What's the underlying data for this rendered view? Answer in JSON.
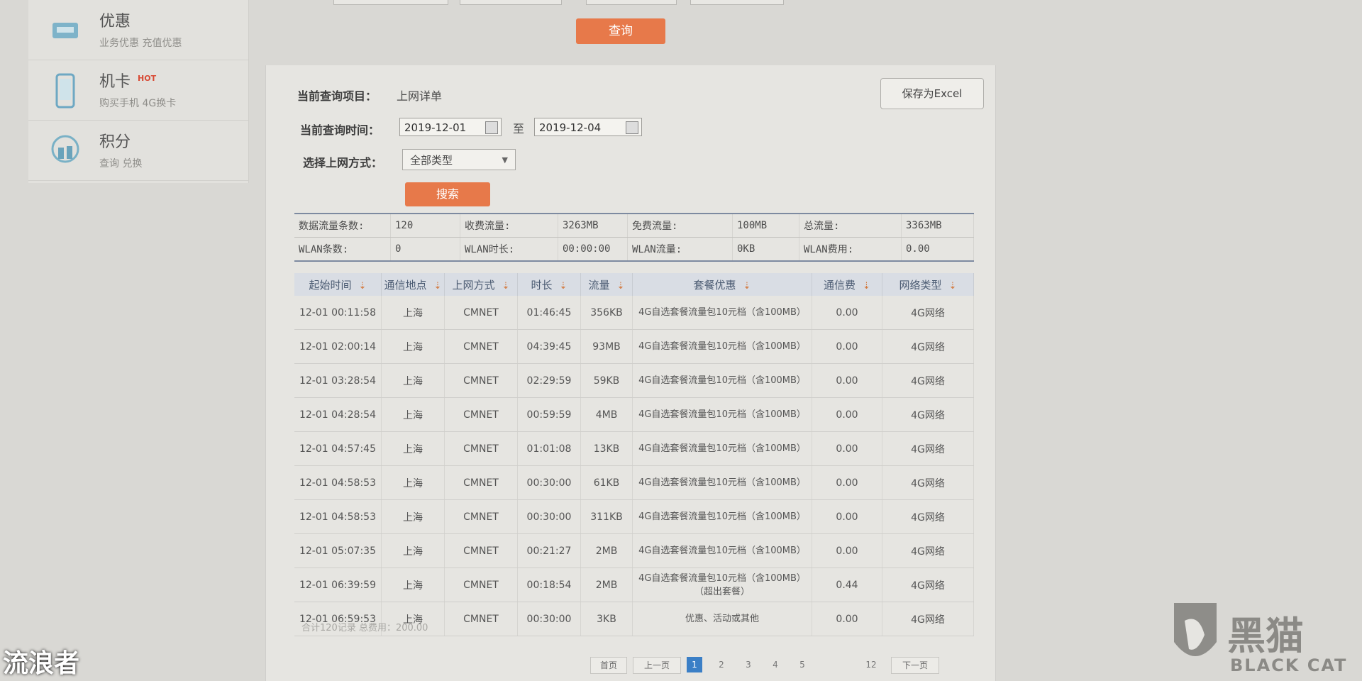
{
  "sidebar": {
    "items": [
      {
        "title": "优惠",
        "sub": "业务优惠 充值优惠",
        "hot": ""
      },
      {
        "title": "机卡",
        "sub": "购买手机 4G换卡",
        "hot": "HOT"
      },
      {
        "title": "积分",
        "sub": "查询 兑换",
        "hot": ""
      }
    ]
  },
  "top": {
    "query_button": "查询"
  },
  "query": {
    "item_label": "当前查询项目：",
    "item_value": "上网详单",
    "save_excel": "保存为Excel",
    "time_label": "当前查询时间：",
    "start_date": "2019-12-01",
    "to": "至",
    "end_date": "2019-12-04",
    "mode_label": "选择上网方式：",
    "mode_value": "全部类型",
    "search_button": "搜索"
  },
  "summary": {
    "rows": [
      [
        "数据流量条数:",
        "120",
        "收费流量:",
        "3263MB",
        "免费流量:",
        "100MB",
        "总流量:",
        "3363MB"
      ],
      [
        "WLAN条数:",
        "0",
        "WLAN时长:",
        "00:00:00",
        "WLAN流量:",
        "0KB",
        "WLAN费用:",
        "0.00"
      ]
    ]
  },
  "table": {
    "headers": [
      "起始时间",
      "通信地点",
      "上网方式",
      "时长",
      "流量",
      "套餐优惠",
      "通信费",
      "网络类型"
    ],
    "rows": [
      [
        "12-01 00:11:58",
        "上海",
        "CMNET",
        "01:46:45",
        "356KB",
        "4G自选套餐流量包10元档（含100MB）",
        "0.00",
        "4G网络"
      ],
      [
        "12-01 02:00:14",
        "上海",
        "CMNET",
        "04:39:45",
        "93MB",
        "4G自选套餐流量包10元档（含100MB）",
        "0.00",
        "4G网络"
      ],
      [
        "12-01 03:28:54",
        "上海",
        "CMNET",
        "02:29:59",
        "59KB",
        "4G自选套餐流量包10元档（含100MB）",
        "0.00",
        "4G网络"
      ],
      [
        "12-01 04:28:54",
        "上海",
        "CMNET",
        "00:59:59",
        "4MB",
        "4G自选套餐流量包10元档（含100MB）",
        "0.00",
        "4G网络"
      ],
      [
        "12-01 04:57:45",
        "上海",
        "CMNET",
        "01:01:08",
        "13KB",
        "4G自选套餐流量包10元档（含100MB）",
        "0.00",
        "4G网络"
      ],
      [
        "12-01 04:58:53",
        "上海",
        "CMNET",
        "00:30:00",
        "61KB",
        "4G自选套餐流量包10元档（含100MB）",
        "0.00",
        "4G网络"
      ],
      [
        "12-01 04:58:53",
        "上海",
        "CMNET",
        "00:30:00",
        "311KB",
        "4G自选套餐流量包10元档（含100MB）",
        "0.00",
        "4G网络"
      ],
      [
        "12-01 05:07:35",
        "上海",
        "CMNET",
        "00:21:27",
        "2MB",
        "4G自选套餐流量包10元档（含100MB）",
        "0.00",
        "4G网络"
      ],
      [
        "12-01 06:39:59",
        "上海",
        "CMNET",
        "00:18:54",
        "2MB",
        "4G自选套餐流量包10元档（含100MB）（超出套餐）",
        "0.44",
        "4G网络"
      ],
      [
        "12-01 06:59:53",
        "上海",
        "CMNET",
        "00:30:00",
        "3KB",
        "优惠、活动或其他",
        "0.00",
        "4G网络"
      ]
    ],
    "footer": "合计120记录 总费用：200.00"
  },
  "pager": {
    "first": "首页",
    "prev": "上一页",
    "pages": [
      "1",
      "2",
      "3",
      "4",
      "5"
    ],
    "last_page": "12",
    "next": "下一页",
    "current": "1"
  },
  "watermark": {
    "left": "流浪者",
    "right_cn": "黑猫",
    "right_en": "BLACK CAT"
  },
  "colors": {
    "accent": "#e7794a",
    "page_current": "#3b7fc6"
  }
}
